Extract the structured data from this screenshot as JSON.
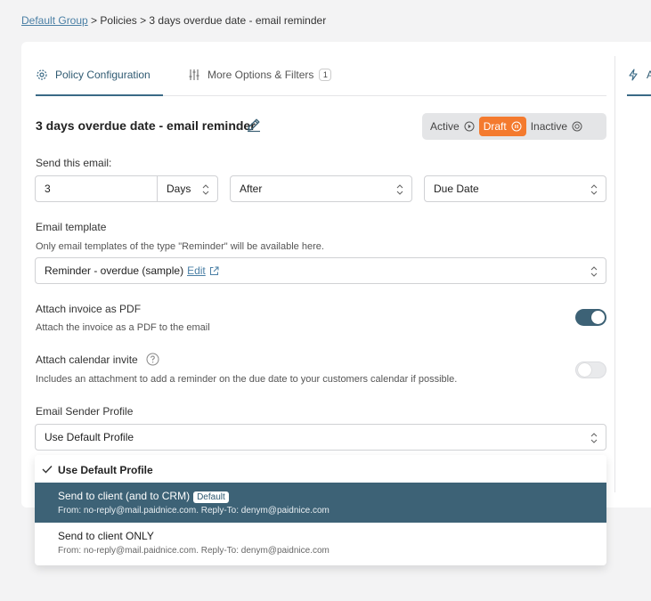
{
  "breadcrumb": {
    "root": "Default Group",
    "rest": " > Policies > 3 days overdue date - email reminder"
  },
  "tabs": [
    {
      "label": "Policy Configuration",
      "icon": "gear-icon"
    },
    {
      "label": "More Options & Filters",
      "icon": "sliders-icon",
      "badge": "1"
    }
  ],
  "right_tab": {
    "label": "A",
    "icon": "lightning-icon"
  },
  "policy": {
    "title": "3 days overdue date - email reminder"
  },
  "status": {
    "options": [
      "Active",
      "Draft",
      "Inactive"
    ],
    "selected": "Draft",
    "draft_color": "#f47a2e"
  },
  "send_email": {
    "label": "Send this email:",
    "count": "3",
    "unit": "Days",
    "relation": "After",
    "reference": "Due Date"
  },
  "email_template": {
    "label": "Email template",
    "help": "Only email templates of the type \"Reminder\" will be available here.",
    "value": "Reminder - overdue (sample)",
    "edit_label": "Edit"
  },
  "attach_pdf": {
    "label": "Attach invoice as PDF",
    "help": "Attach the invoice as a PDF to the email",
    "enabled": true
  },
  "attach_calendar": {
    "label": "Attach calendar invite",
    "help": "Includes an attachment to add a reminder on the due date to your customers calendar if possible.",
    "enabled": false
  },
  "sender_profile": {
    "label": "Email Sender Profile",
    "value": "Use Default Profile",
    "options": [
      {
        "title": "Use Default Profile",
        "checked": true
      },
      {
        "title": "Send to client (and to CRM)",
        "badge": "Default",
        "sub": "From: no-reply@mail.paidnice.com. Reply-To: denym@paidnice.com",
        "highlighted": true
      },
      {
        "title": "Send to client ONLY",
        "sub": "From: no-reply@mail.paidnice.com. Reply-To: denym@paidnice.com"
      }
    ]
  },
  "colors": {
    "accent": "#3d6276",
    "link": "#4a7fa5"
  }
}
